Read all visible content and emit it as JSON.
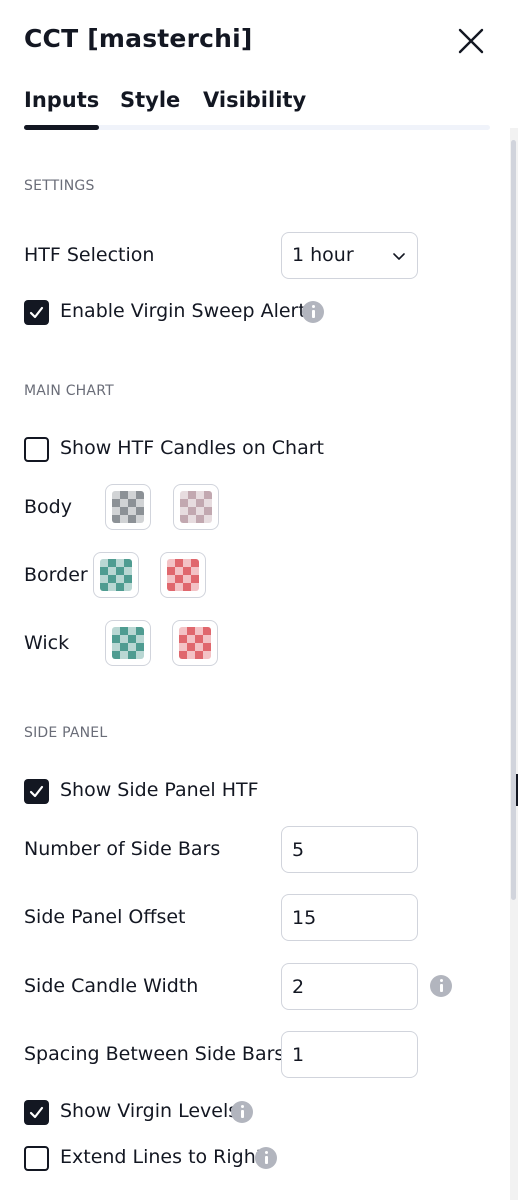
{
  "dialog": {
    "title": "CCT [masterchi]"
  },
  "tabs": [
    {
      "label": "Inputs",
      "active": true
    },
    {
      "label": "Style",
      "active": false
    },
    {
      "label": "Visibility",
      "active": false
    }
  ],
  "settings": {
    "section_label": "SETTINGS",
    "htf_selection": {
      "label": "HTF Selection",
      "value": "1 hour"
    },
    "virgin_sweep_alerts": {
      "label": "Enable Virgin Sweep Alerts",
      "checked": true
    }
  },
  "main_chart": {
    "section_label": "MAIN CHART",
    "show_htf_candles": {
      "label": "Show HTF Candles on Chart",
      "checked": false
    },
    "body": {
      "label": "Body",
      "colors": [
        "#8c9196",
        "#c2a8b0"
      ]
    },
    "border": {
      "label": "Border",
      "colors": [
        "#4f9c91",
        "#e0676d"
      ]
    },
    "wick": {
      "label": "Wick",
      "colors": [
        "#4f9c91",
        "#e0676d"
      ]
    }
  },
  "side_panel": {
    "section_label": "SIDE PANEL",
    "show_side_panel": {
      "label": "Show Side Panel HTF",
      "checked": true
    },
    "number_of_side_bars": {
      "label": "Number of Side Bars",
      "value": "5"
    },
    "side_panel_offset": {
      "label": "Side Panel Offset",
      "value": "15"
    },
    "side_candle_width": {
      "label": "Side Candle Width",
      "value": "2"
    },
    "spacing_between_side_bars": {
      "label": "Spacing Between Side Bars",
      "value": "1"
    },
    "show_virgin_levels": {
      "label": "Show Virgin Levels",
      "checked": true
    },
    "extend_lines_right": {
      "label": "Extend Lines to Right",
      "checked": false
    }
  },
  "colors": {
    "text": "#131722",
    "muted": "#6a6d78",
    "border": "#d1d4dc",
    "info": "#b2b5be"
  }
}
